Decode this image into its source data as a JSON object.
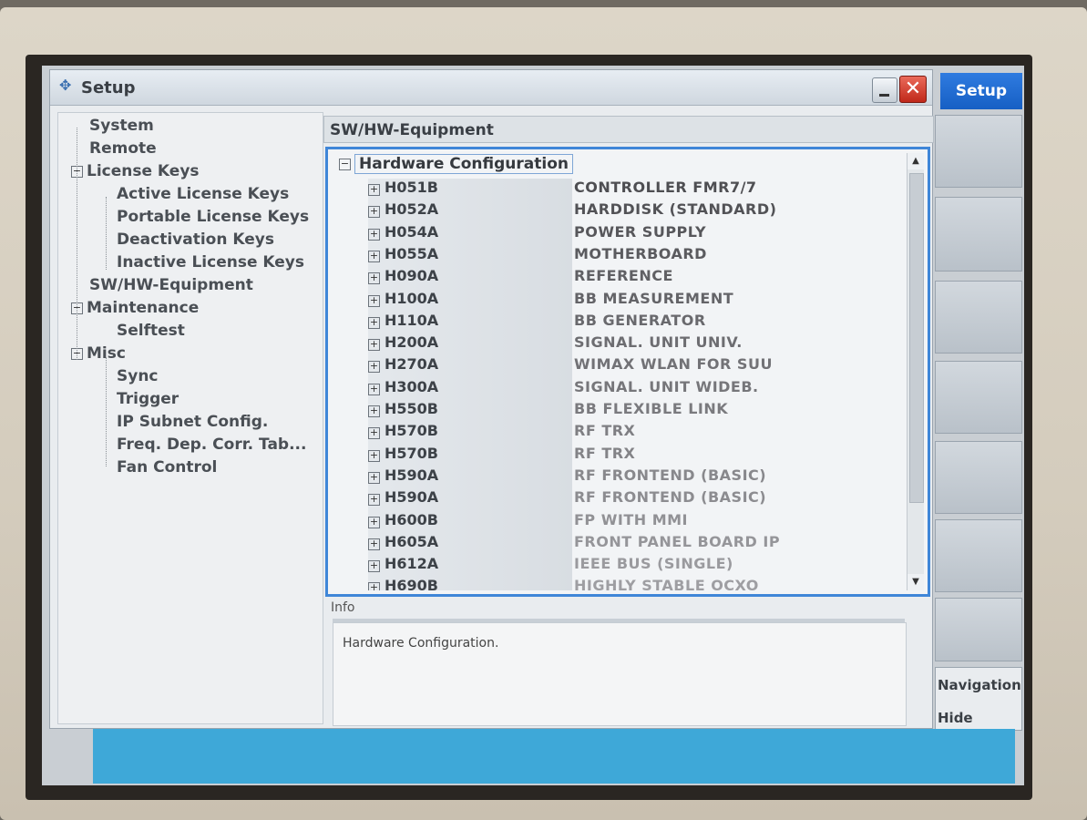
{
  "window": {
    "title": "Setup"
  },
  "nav": {
    "items": [
      {
        "label": "System",
        "level": 1,
        "expander": ""
      },
      {
        "label": "Remote",
        "level": 1,
        "expander": ""
      },
      {
        "label": "License Keys",
        "level": 0,
        "expander": "⊟"
      },
      {
        "label": "Active License Keys",
        "level": 2,
        "expander": ""
      },
      {
        "label": "Portable License Keys",
        "level": 2,
        "expander": ""
      },
      {
        "label": "Deactivation Keys",
        "level": 2,
        "expander": ""
      },
      {
        "label": "Inactive License Keys",
        "level": 2,
        "expander": ""
      },
      {
        "label": "SW/HW-Equipment",
        "level": 1,
        "expander": ""
      },
      {
        "label": "Maintenance",
        "level": 0,
        "expander": "⊟"
      },
      {
        "label": "Selftest",
        "level": 2,
        "expander": ""
      },
      {
        "label": "Misc",
        "level": 0,
        "expander": "⊟"
      },
      {
        "label": "Sync",
        "level": 2,
        "expander": ""
      },
      {
        "label": "Trigger",
        "level": 2,
        "expander": ""
      },
      {
        "label": "IP Subnet Config.",
        "level": 2,
        "expander": ""
      },
      {
        "label": "Freq. Dep. Corr. Tab...",
        "level": 2,
        "expander": ""
      },
      {
        "label": "Fan Control",
        "level": 2,
        "expander": ""
      }
    ]
  },
  "content": {
    "section_title": "SW/HW-Equipment",
    "tree_root": "Hardware Configuration",
    "rows": [
      {
        "code": "H051B",
        "desc": "CONTROLLER FMR7/7"
      },
      {
        "code": "H052A",
        "desc": "HARDDISK (STANDARD)"
      },
      {
        "code": "H054A",
        "desc": "POWER SUPPLY"
      },
      {
        "code": "H055A",
        "desc": "MOTHERBOARD"
      },
      {
        "code": "H090A",
        "desc": "REFERENCE"
      },
      {
        "code": "H100A",
        "desc": "BB MEASUREMENT"
      },
      {
        "code": "H110A",
        "desc": "BB GENERATOR"
      },
      {
        "code": "H200A",
        "desc": "SIGNAL. UNIT UNIV."
      },
      {
        "code": "H270A",
        "desc": "WIMAX WLAN FOR SUU"
      },
      {
        "code": "H300A",
        "desc": "SIGNAL. UNIT WIDEB."
      },
      {
        "code": "H550B",
        "desc": "BB FLEXIBLE LINK"
      },
      {
        "code": "H570B",
        "desc": "RF TRX"
      },
      {
        "code": "H570B",
        "desc": "RF TRX"
      },
      {
        "code": "H590A",
        "desc": "RF FRONTEND (BASIC)"
      },
      {
        "code": "H590A",
        "desc": "RF FRONTEND (BASIC)"
      },
      {
        "code": "H600B",
        "desc": "FP WITH MMI"
      },
      {
        "code": "H605A",
        "desc": "FRONT PANEL BOARD IP"
      },
      {
        "code": "H612A",
        "desc": "IEEE BUS (SINGLE)"
      },
      {
        "code": "H690B",
        "desc": "HIGHLY STABLE OCXO"
      }
    ],
    "info_label": "Info",
    "info_text": "Hardware Configuration."
  },
  "softkeys": {
    "active": "Setup",
    "navigation": "Navigation",
    "hide": "Hide"
  },
  "colors": {
    "accent": "#3f86d8",
    "softkey_active": "#1f6fd6",
    "status_bar": "#3ea8d8",
    "close_button": "#d0392b"
  }
}
